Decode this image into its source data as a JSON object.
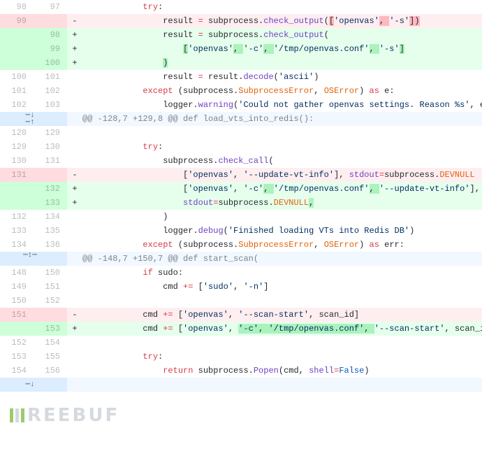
{
  "watermark": "REEBUF",
  "rows": [
    {
      "type": "ctx",
      "old": "98",
      "new": "97",
      "mark": "",
      "tokens": [
        {
          "t": "            ",
          "c": ""
        },
        {
          "t": "try",
          "c": "kw"
        },
        {
          "t": ":",
          "c": ""
        }
      ]
    },
    {
      "type": "del",
      "old": "99",
      "new": "",
      "mark": "-",
      "tokens": [
        {
          "t": "                result ",
          "c": ""
        },
        {
          "t": "=",
          "c": "op"
        },
        {
          "t": " subprocess.",
          "c": ""
        },
        {
          "t": "check_output",
          "c": "fn"
        },
        {
          "t": "(",
          "c": ""
        },
        {
          "t": "[",
          "c": "idel"
        },
        {
          "t": "'openvas'",
          "c": "str"
        },
        {
          "t": ", ",
          "c": "idel"
        },
        {
          "t": "'-s'",
          "c": "str"
        },
        {
          "t": "])",
          "c": "idel"
        }
      ]
    },
    {
      "type": "add",
      "old": "",
      "new": "98",
      "mark": "+",
      "tokens": [
        {
          "t": "                result ",
          "c": ""
        },
        {
          "t": "=",
          "c": "op"
        },
        {
          "t": " subprocess.",
          "c": ""
        },
        {
          "t": "check_output",
          "c": "fn"
        },
        {
          "t": "(",
          "c": ""
        }
      ]
    },
    {
      "type": "add",
      "old": "",
      "new": "99",
      "mark": "+",
      "tokens": [
        {
          "t": "                    ",
          "c": ""
        },
        {
          "t": "[",
          "c": "iadd"
        },
        {
          "t": "'openvas'",
          "c": "str"
        },
        {
          "t": ", ",
          "c": "iadd"
        },
        {
          "t": "'-c'",
          "c": "str"
        },
        {
          "t": ", ",
          "c": "iadd"
        },
        {
          "t": "'/tmp/openvas.conf'",
          "c": "str"
        },
        {
          "t": ", ",
          "c": "iadd"
        },
        {
          "t": "'-s'",
          "c": "str"
        },
        {
          "t": "]",
          "c": "iadd"
        }
      ]
    },
    {
      "type": "add",
      "old": "",
      "new": "100",
      "mark": "+",
      "tokens": [
        {
          "t": "                ",
          "c": ""
        },
        {
          "t": ")",
          "c": "iadd"
        }
      ]
    },
    {
      "type": "ctx",
      "old": "100",
      "new": "101",
      "mark": "",
      "tokens": [
        {
          "t": "                result ",
          "c": ""
        },
        {
          "t": "=",
          "c": "op"
        },
        {
          "t": " result.",
          "c": ""
        },
        {
          "t": "decode",
          "c": "fn"
        },
        {
          "t": "(",
          "c": ""
        },
        {
          "t": "'ascii'",
          "c": "str"
        },
        {
          "t": ")",
          "c": ""
        }
      ]
    },
    {
      "type": "ctx",
      "old": "101",
      "new": "102",
      "mark": "",
      "tokens": [
        {
          "t": "            ",
          "c": ""
        },
        {
          "t": "except",
          "c": "kw"
        },
        {
          "t": " (subprocess.",
          "c": ""
        },
        {
          "t": "SubprocessError",
          "c": "err"
        },
        {
          "t": ", ",
          "c": ""
        },
        {
          "t": "OSError",
          "c": "err"
        },
        {
          "t": ") ",
          "c": ""
        },
        {
          "t": "as",
          "c": "kw"
        },
        {
          "t": " e:",
          "c": ""
        }
      ]
    },
    {
      "type": "ctx",
      "old": "102",
      "new": "103",
      "mark": "",
      "tokens": [
        {
          "t": "                logger.",
          "c": ""
        },
        {
          "t": "warning",
          "c": "fn"
        },
        {
          "t": "(",
          "c": ""
        },
        {
          "t": "'Could not gather openvas settings. Reason %s'",
          "c": "str"
        },
        {
          "t": ", e)",
          "c": ""
        }
      ]
    },
    {
      "type": "hunk",
      "hunktext": "@@ -128,7 +129,8 @@ def load_vts_into_redis():",
      "arrows": "both"
    },
    {
      "type": "ctx",
      "old": "128",
      "new": "129",
      "mark": "",
      "tokens": [
        {
          "t": "",
          "c": ""
        }
      ]
    },
    {
      "type": "ctx",
      "old": "129",
      "new": "130",
      "mark": "",
      "tokens": [
        {
          "t": "            ",
          "c": ""
        },
        {
          "t": "try",
          "c": "kw"
        },
        {
          "t": ":",
          "c": ""
        }
      ]
    },
    {
      "type": "ctx",
      "old": "130",
      "new": "131",
      "mark": "",
      "tokens": [
        {
          "t": "                subprocess.",
          "c": ""
        },
        {
          "t": "check_call",
          "c": "fn"
        },
        {
          "t": "(",
          "c": ""
        }
      ]
    },
    {
      "type": "del",
      "old": "131",
      "new": "",
      "mark": "-",
      "tokens": [
        {
          "t": "                    [",
          "c": ""
        },
        {
          "t": "'openvas'",
          "c": "str"
        },
        {
          "t": ", ",
          "c": ""
        },
        {
          "t": "'--update-vt-info'",
          "c": "str"
        },
        {
          "t": "], ",
          "c": ""
        },
        {
          "t": "stdout",
          "c": "fn"
        },
        {
          "t": "=",
          "c": "op"
        },
        {
          "t": "subprocess.",
          "c": ""
        },
        {
          "t": "DEVNULL",
          "c": "err"
        }
      ]
    },
    {
      "type": "add",
      "old": "",
      "new": "132",
      "mark": "+",
      "tokens": [
        {
          "t": "                    [",
          "c": ""
        },
        {
          "t": "'openvas'",
          "c": "str"
        },
        {
          "t": ", ",
          "c": ""
        },
        {
          "t": "'-c'",
          "c": "str"
        },
        {
          "t": ", ",
          "c": "iadd"
        },
        {
          "t": "'/tmp/openvas.conf'",
          "c": "str"
        },
        {
          "t": ", ",
          "c": "iadd"
        },
        {
          "t": "'--update-vt-info'",
          "c": "str"
        },
        {
          "t": "],",
          "c": ""
        }
      ]
    },
    {
      "type": "add",
      "old": "",
      "new": "133",
      "mark": "+",
      "tokens": [
        {
          "t": "                    ",
          "c": ""
        },
        {
          "t": "stdout",
          "c": "fn"
        },
        {
          "t": "=",
          "c": "op"
        },
        {
          "t": "subprocess.",
          "c": ""
        },
        {
          "t": "DEVNULL",
          "c": "err"
        },
        {
          "t": ",",
          "c": "iadd"
        }
      ]
    },
    {
      "type": "ctx",
      "old": "132",
      "new": "134",
      "mark": "",
      "tokens": [
        {
          "t": "                )",
          "c": ""
        }
      ]
    },
    {
      "type": "ctx",
      "old": "133",
      "new": "135",
      "mark": "",
      "tokens": [
        {
          "t": "                logger.",
          "c": ""
        },
        {
          "t": "debug",
          "c": "fn"
        },
        {
          "t": "(",
          "c": ""
        },
        {
          "t": "'Finished loading VTs into Redis DB'",
          "c": "str"
        },
        {
          "t": ")",
          "c": ""
        }
      ]
    },
    {
      "type": "ctx",
      "old": "134",
      "new": "136",
      "mark": "",
      "tokens": [
        {
          "t": "            ",
          "c": ""
        },
        {
          "t": "except",
          "c": "kw"
        },
        {
          "t": " (subprocess.",
          "c": ""
        },
        {
          "t": "SubprocessError",
          "c": "err"
        },
        {
          "t": ", ",
          "c": ""
        },
        {
          "t": "OSError",
          "c": "err"
        },
        {
          "t": ") ",
          "c": ""
        },
        {
          "t": "as",
          "c": "kw"
        },
        {
          "t": " err:",
          "c": ""
        }
      ]
    },
    {
      "type": "hunk",
      "hunktext": "@@ -148,7 +150,7 @@ def start_scan(",
      "arrows": "center"
    },
    {
      "type": "ctx",
      "old": "148",
      "new": "150",
      "mark": "",
      "tokens": [
        {
          "t": "            ",
          "c": ""
        },
        {
          "t": "if",
          "c": "kw"
        },
        {
          "t": " sudo:",
          "c": ""
        }
      ]
    },
    {
      "type": "ctx",
      "old": "149",
      "new": "151",
      "mark": "",
      "tokens": [
        {
          "t": "                cmd ",
          "c": ""
        },
        {
          "t": "+=",
          "c": "op"
        },
        {
          "t": " [",
          "c": ""
        },
        {
          "t": "'sudo'",
          "c": "str"
        },
        {
          "t": ", ",
          "c": ""
        },
        {
          "t": "'-n'",
          "c": "str"
        },
        {
          "t": "]",
          "c": ""
        }
      ]
    },
    {
      "type": "ctx",
      "old": "150",
      "new": "152",
      "mark": "",
      "tokens": [
        {
          "t": "",
          "c": ""
        }
      ]
    },
    {
      "type": "del",
      "old": "151",
      "new": "",
      "mark": "-",
      "tokens": [
        {
          "t": "            cmd ",
          "c": ""
        },
        {
          "t": "+=",
          "c": "op"
        },
        {
          "t": " [",
          "c": ""
        },
        {
          "t": "'openvas'",
          "c": "str"
        },
        {
          "t": ", ",
          "c": ""
        },
        {
          "t": "'--scan-start'",
          "c": "str"
        },
        {
          "t": ", scan_id]",
          "c": ""
        }
      ]
    },
    {
      "type": "add",
      "old": "",
      "new": "153",
      "mark": "+",
      "tokens": [
        {
          "t": "            cmd ",
          "c": ""
        },
        {
          "t": "+=",
          "c": "op"
        },
        {
          "t": " [",
          "c": ""
        },
        {
          "t": "'openvas'",
          "c": "str"
        },
        {
          "t": ", ",
          "c": ""
        },
        {
          "t": "'-c'",
          "c": "str iadd"
        },
        {
          "t": ", ",
          "c": "iadd"
        },
        {
          "t": "'/tmp/openvas.conf'",
          "c": "str iadd"
        },
        {
          "t": ", ",
          "c": "iadd"
        },
        {
          "t": "'--scan-start'",
          "c": "str"
        },
        {
          "t": ", scan_id]",
          "c": ""
        }
      ]
    },
    {
      "type": "ctx",
      "old": "152",
      "new": "154",
      "mark": "",
      "tokens": [
        {
          "t": "",
          "c": ""
        }
      ]
    },
    {
      "type": "ctx",
      "old": "153",
      "new": "155",
      "mark": "",
      "tokens": [
        {
          "t": "            ",
          "c": ""
        },
        {
          "t": "try",
          "c": "kw"
        },
        {
          "t": ":",
          "c": ""
        }
      ]
    },
    {
      "type": "ctx",
      "old": "154",
      "new": "156",
      "mark": "",
      "tokens": [
        {
          "t": "                ",
          "c": ""
        },
        {
          "t": "return",
          "c": "kw"
        },
        {
          "t": " subprocess.",
          "c": ""
        },
        {
          "t": "Popen",
          "c": "fn"
        },
        {
          "t": "(cmd, ",
          "c": ""
        },
        {
          "t": "shell",
          "c": "fn"
        },
        {
          "t": "=",
          "c": "op"
        },
        {
          "t": "False",
          "c": "const"
        },
        {
          "t": ")",
          "c": ""
        }
      ]
    },
    {
      "type": "tail"
    }
  ]
}
